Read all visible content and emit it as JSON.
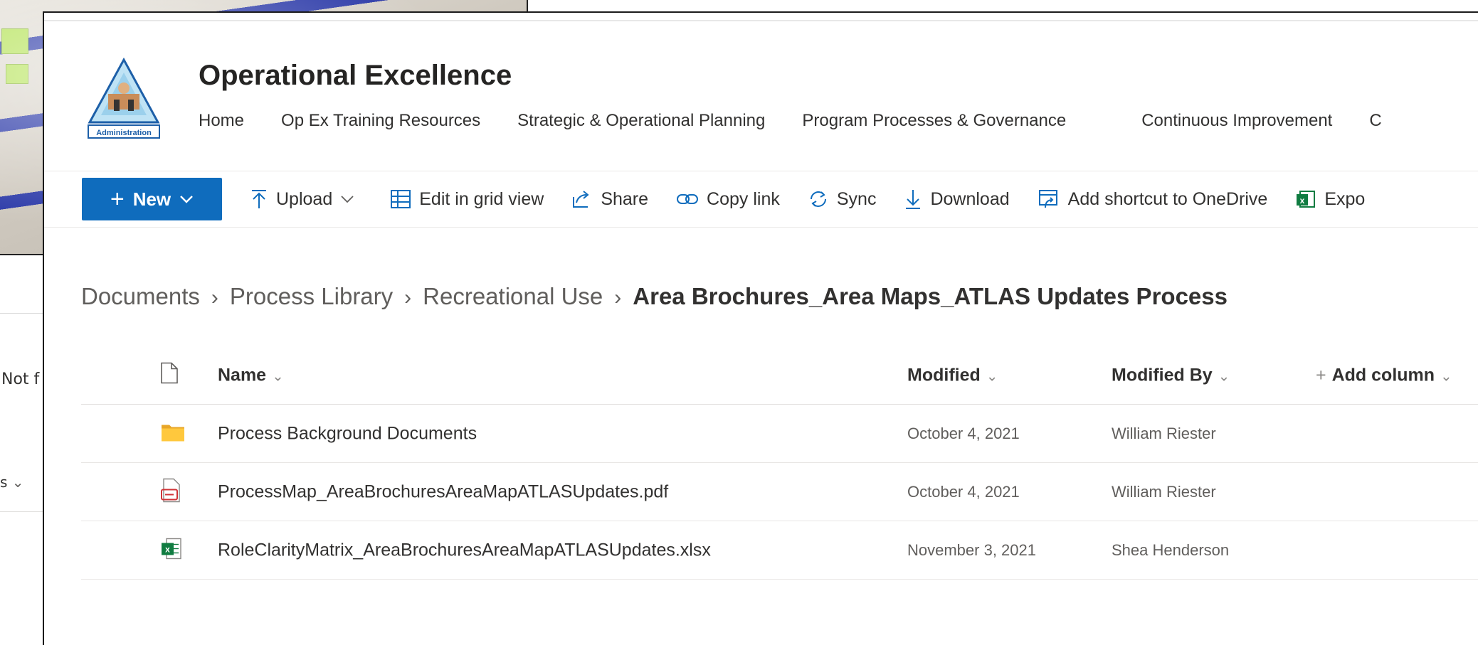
{
  "background_window": {
    "filter_text": "Not f",
    "views_text": "s"
  },
  "site": {
    "logo_text": "Administration",
    "title": "Operational Excellence",
    "nav": [
      "Home",
      "Op Ex Training Resources",
      "Strategic & Operational Planning",
      "Program Processes & Governance",
      "Continuous Improvement",
      "C"
    ]
  },
  "commandbar": {
    "new_label": "New",
    "upload_label": "Upload",
    "grid_label": "Edit in grid view",
    "share_label": "Share",
    "copylink_label": "Copy link",
    "sync_label": "Sync",
    "download_label": "Download",
    "shortcut_label": "Add shortcut to OneDrive",
    "export_label": "Expo"
  },
  "breadcrumb": {
    "items": [
      "Documents",
      "Process Library",
      "Recreational Use"
    ],
    "current": "Area Brochures_Area Maps_ATLAS Updates Process"
  },
  "list": {
    "headers": {
      "name": "Name",
      "modified": "Modified",
      "modified_by": "Modified By",
      "add_column": "Add column"
    },
    "rows": [
      {
        "type": "folder",
        "name": "Process Background Documents",
        "modified": "October 4, 2021",
        "modified_by": "William Riester"
      },
      {
        "type": "pdf",
        "name": "ProcessMap_AreaBrochuresAreaMapATLASUpdates.pdf",
        "modified": "October 4, 2021",
        "modified_by": "William Riester"
      },
      {
        "type": "xlsx",
        "name": "RoleClarityMatrix_AreaBrochuresAreaMapATLASUpdates.xlsx",
        "modified": "November 3, 2021",
        "modified_by": "Shea Henderson"
      }
    ]
  },
  "colors": {
    "accent": "#0f6cbd",
    "folder": "#ffc83d",
    "pdf": "#d13438",
    "excel": "#107c41"
  }
}
